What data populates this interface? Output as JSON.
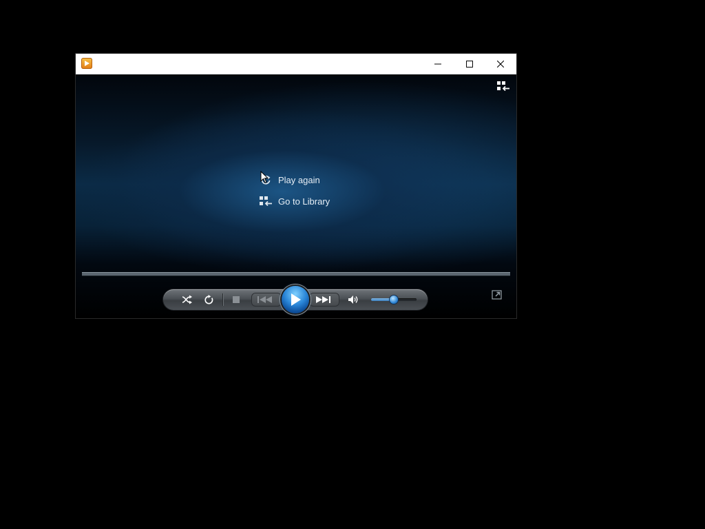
{
  "window": {
    "app_icon": "media-player-icon",
    "controls": {
      "minimize": "minimize-icon",
      "maximize": "maximize-icon",
      "close": "close-icon"
    }
  },
  "video_area": {
    "corner_icon": "switch-to-library-icon",
    "menu": [
      {
        "label": "Play again",
        "icon": "replay-icon"
      },
      {
        "label": "Go to Library",
        "icon": "library-icon"
      }
    ]
  },
  "seek": {
    "progress": 1.0
  },
  "controls": {
    "shuffle_icon": "shuffle-icon",
    "repeat_icon": "repeat-icon",
    "stop_icon": "stop-icon",
    "previous_icon": "previous-icon",
    "play_icon": "play-icon",
    "next_icon": "next-icon",
    "mute_icon": "speaker-icon",
    "volume": 0.5,
    "fullscreen_icon": "fullscreen-icon"
  },
  "colors": {
    "accent": "#2a86d8",
    "menu_text": "#e6eef5"
  }
}
